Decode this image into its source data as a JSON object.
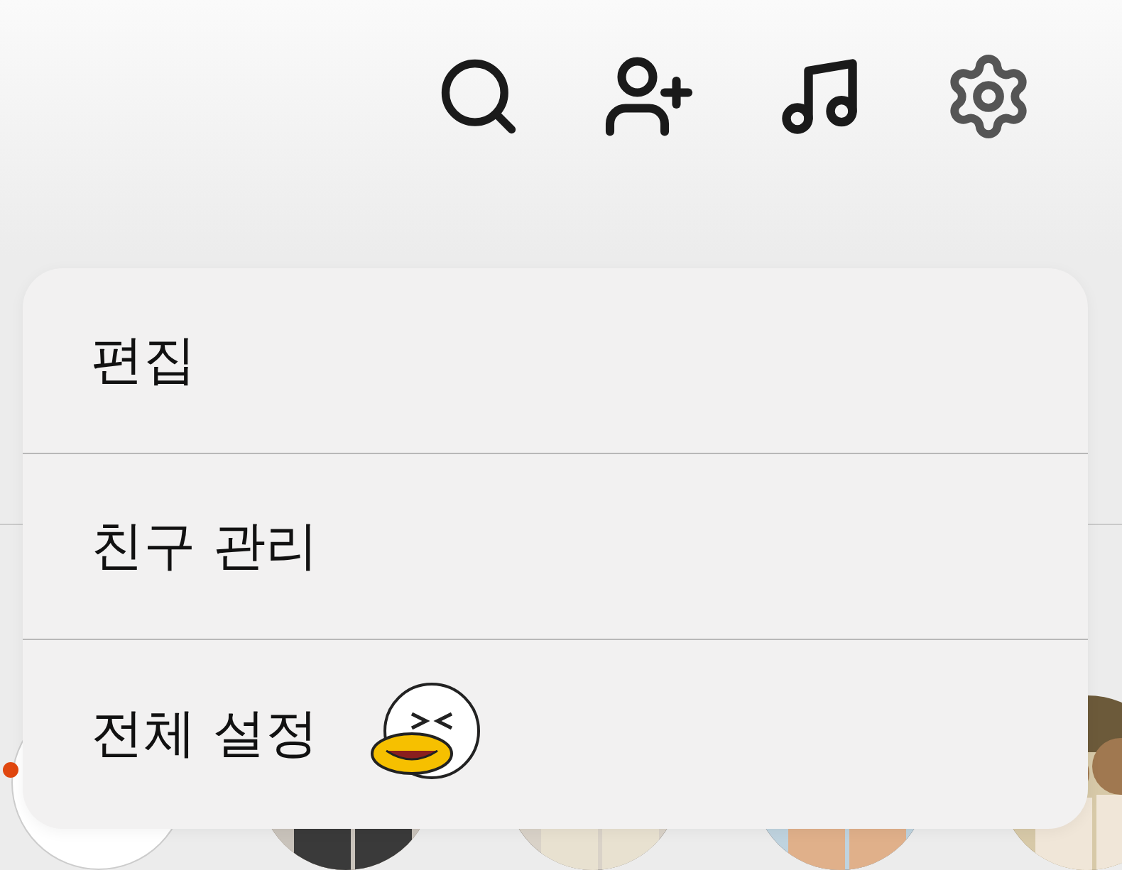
{
  "menu": {
    "items": [
      {
        "label": "편집",
        "kind": "text"
      },
      {
        "label": "친구 관리",
        "kind": "text"
      },
      {
        "label": "전체 설정",
        "kind": "sticker"
      }
    ]
  },
  "avatars": [
    {
      "kind": "pattern"
    },
    {
      "kind": "picture"
    },
    {
      "kind": "picture"
    },
    {
      "kind": "picture"
    },
    {
      "kind": "picture"
    }
  ]
}
